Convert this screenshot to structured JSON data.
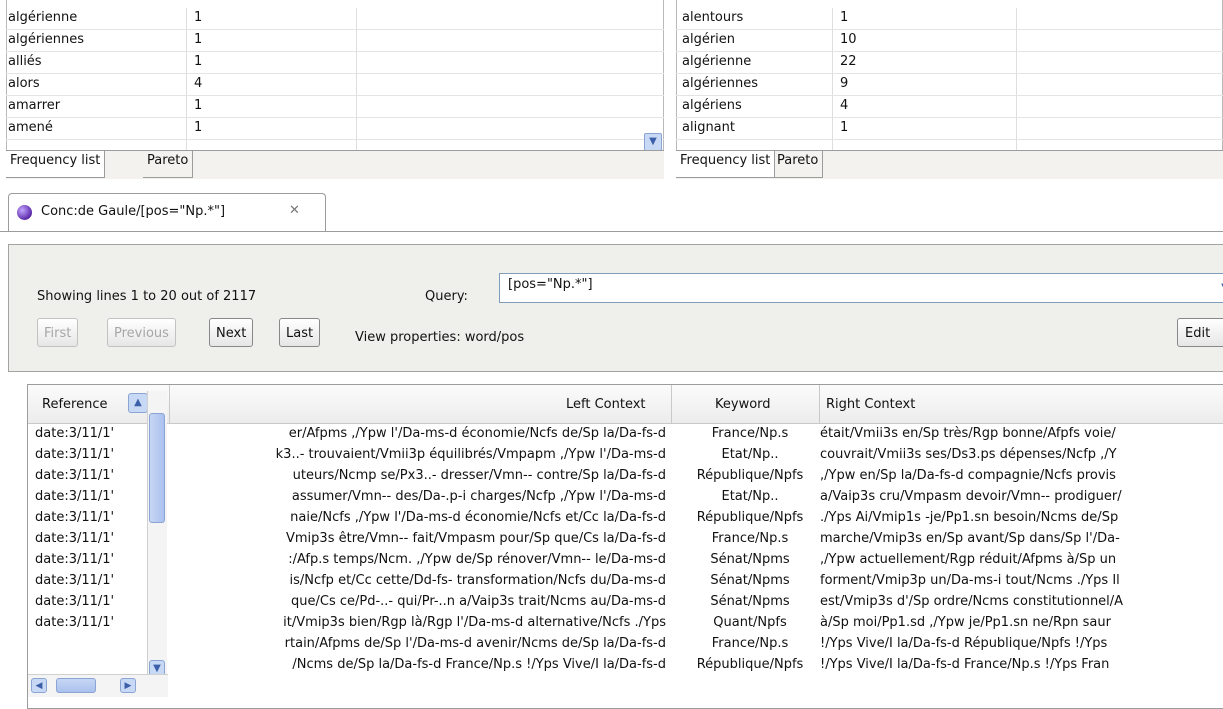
{
  "freq_left": {
    "rows": [
      {
        "word": "algérienne",
        "count": "1"
      },
      {
        "word": "algériennes",
        "count": "1"
      },
      {
        "word": "alliés",
        "count": "1"
      },
      {
        "word": "alors",
        "count": "4"
      },
      {
        "word": "amarrer",
        "count": "1"
      },
      {
        "word": "amené",
        "count": "1"
      }
    ],
    "tabs": [
      "Frequency list",
      "Pareto"
    ]
  },
  "freq_right": {
    "rows": [
      {
        "word": "alentours",
        "count": "1"
      },
      {
        "word": "algérien",
        "count": "10"
      },
      {
        "word": "algérienne",
        "count": "22"
      },
      {
        "word": "algériennes",
        "count": "9"
      },
      {
        "word": "algériens",
        "count": "4"
      },
      {
        "word": "alignant",
        "count": "1"
      }
    ],
    "tabs": [
      "Frequency list",
      "Pareto"
    ]
  },
  "editor_tab": {
    "title": "Conc:de Gaule/[pos=\"Np.*\"]",
    "close_glyph": "✕",
    "icon": "concordance-globe-icon"
  },
  "query_panel": {
    "showing": "Showing lines 1 to 20 out of 2117",
    "query_label": "Query:",
    "query_value": "[pos=\"Np.*\"]",
    "buttons": {
      "first": "First",
      "previous": "Previous",
      "next": "Next",
      "last": "Last",
      "edit": "Edit"
    },
    "view_properties": "View properties: word/pos"
  },
  "concordance": {
    "headers": {
      "reference": "Reference",
      "left": "Left Context",
      "keyword": "Keyword",
      "right": "Right Context"
    },
    "rows": [
      {
        "ref": "date:3/11/1'",
        "left": "er/Afpms ,/Ypw l'/Da-ms-d économie/Ncfs de/Sp la/Da-fs-d",
        "kw": "France/Np.s",
        "right": "était/Vmii3s en/Sp très/Rgp bonne/Afpfs voie/"
      },
      {
        "ref": "date:3/11/1'",
        "left": "k3..- trouvaient/Vmii3p équilibrés/Vmpapm ,/Ypw l'/Da-ms-d",
        "kw": "Etat/Np..",
        "right": "couvrait/Vmii3s ses/Ds3.ps dépenses/Ncfp ,/Y"
      },
      {
        "ref": "date:3/11/1'",
        "left": "uteurs/Ncmp se/Px3..- dresser/Vmn-- contre/Sp la/Da-fs-d",
        "kw": "République/Npfs",
        "right": ",/Ypw en/Sp la/Da-fs-d compagnie/Ncfs provis"
      },
      {
        "ref": "date:3/11/1'",
        "left": "assumer/Vmn-- des/Da-.p-i charges/Ncfp ,/Ypw l'/Da-ms-d",
        "kw": "Etat/Np..",
        "right": "a/Vaip3s cru/Vmpasm devoir/Vmn-- prodiguer/"
      },
      {
        "ref": "date:3/11/1'",
        "left": "naie/Ncfs ,/Ypw l'/Da-ms-d économie/Ncfs et/Cc la/Da-fs-d",
        "kw": "République/Npfs",
        "right": "./Yps Ai/Vmip1s -je/Pp1.sn besoin/Ncms de/Sp"
      },
      {
        "ref": "date:3/11/1'",
        "left": "Vmip3s être/Vmn-- fait/Vmpasm pour/Sp que/Cs la/Da-fs-d",
        "kw": "France/Np.s",
        "right": "marche/Vmip3s en/Sp avant/Sp dans/Sp l'/Da-"
      },
      {
        "ref": "date:3/11/1'",
        "left": ":/Afp.s temps/Ncm. ,/Ypw de/Sp rénover/Vmn-- le/Da-ms-d",
        "kw": "Sénat/Npms",
        "right": ",/Ypw actuellement/Rgp réduit/Afpms à/Sp un"
      },
      {
        "ref": "date:3/11/1'",
        "left": "is/Ncfp et/Cc cette/Dd-fs- transformation/Ncfs du/Da-ms-d",
        "kw": "Sénat/Npms",
        "right": "forment/Vmip3p un/Da-ms-i tout/Ncms ./Yps Il"
      },
      {
        "ref": "date:3/11/1'",
        "left": "que/Cs ce/Pd-..- qui/Pr-..n a/Vaip3s trait/Ncms au/Da-ms-d",
        "kw": "Sénat/Npms",
        "right": "est/Vmip3s d'/Sp ordre/Ncms constitutionnel/A"
      },
      {
        "ref": "date:3/11/1'",
        "left": "it/Vmip3s bien/Rgp là/Rgp l'/Da-ms-d alternative/Ncfs ./Yps",
        "kw": "Quant/Npfs",
        "right": "à/Sp moi/Pp1.sd ,/Ypw je/Pp1.sn ne/Rpn saur"
      },
      {
        "ref": "",
        "left": "rtain/Afpms de/Sp l'/Da-ms-d avenir/Ncms de/Sp la/Da-fs-d",
        "kw": "France/Np.s",
        "right": "!/Yps Vive/I la/Da-fs-d République/Npfs !/Yps"
      },
      {
        "ref": "",
        "left": "/Ncms de/Sp la/Da-fs-d France/Np.s !/Yps Vive/I la/Da-fs-d",
        "kw": "République/Npfs",
        "right": "!/Yps Vive/I la/Da-fs-d France/Np.s !/Yps Fran"
      }
    ]
  },
  "colors": {
    "panel_bg": "#efefeb",
    "tab_bg": "#f3f2ee",
    "scroll_accent": "#aac1ee"
  }
}
